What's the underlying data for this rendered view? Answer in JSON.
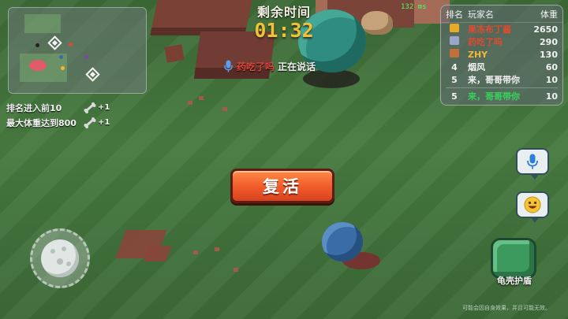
{
  "timer": {
    "label": "剩余时间",
    "value": "01:32"
  },
  "ping": "132 ms",
  "voice": {
    "speaker": "药吃了吗",
    "status": "正在说话"
  },
  "tasks": [
    {
      "label": "排名进入前10",
      "reward": "+1",
      "icon": "bone-icon"
    },
    {
      "label": "最大体重达到800",
      "reward": "+1",
      "icon": "bone-icon"
    }
  ],
  "leaderboard": {
    "headers": {
      "rank": "排名",
      "player": "玩家名",
      "weight": "体重"
    },
    "rows": [
      {
        "rank": "1",
        "name": "果冻布丁酱",
        "weight": "2650",
        "name_color": "#e04a2f",
        "badge": "gold-crown-icon"
      },
      {
        "rank": "2",
        "name": "药吃了吗",
        "weight": "290",
        "name_color": "#e04a2f",
        "badge": "silver-crown-icon"
      },
      {
        "rank": "3",
        "name": "ZHY",
        "weight": "130",
        "name_color": "#f2b63a",
        "badge": "bronze-crown-icon"
      },
      {
        "rank": "4",
        "name": "烟风",
        "weight": "60",
        "name_color": "#f2f2f2",
        "badge": ""
      },
      {
        "rank": "5",
        "name": "来，哥哥带你",
        "weight": "10",
        "name_color": "#f2f2f2",
        "badge": ""
      }
    ],
    "self": {
      "rank": "5",
      "name": "来，哥哥带你",
      "weight": "10",
      "name_color": "#35d35a"
    }
  },
  "actions": {
    "revive_label": "复活",
    "shell_label": "龟壳护盾"
  },
  "footer_note": "可能会因自身效果，并且可能无效。",
  "icons": {
    "voice_chat": "microphone-icon",
    "emoji": "emoji-icon",
    "shell": "turtle-shell-icon"
  },
  "colors": {
    "timer": "#f1c233",
    "revive": "#f05a2a",
    "ping": "#49ff6a",
    "self_highlight": "#35d35a"
  }
}
